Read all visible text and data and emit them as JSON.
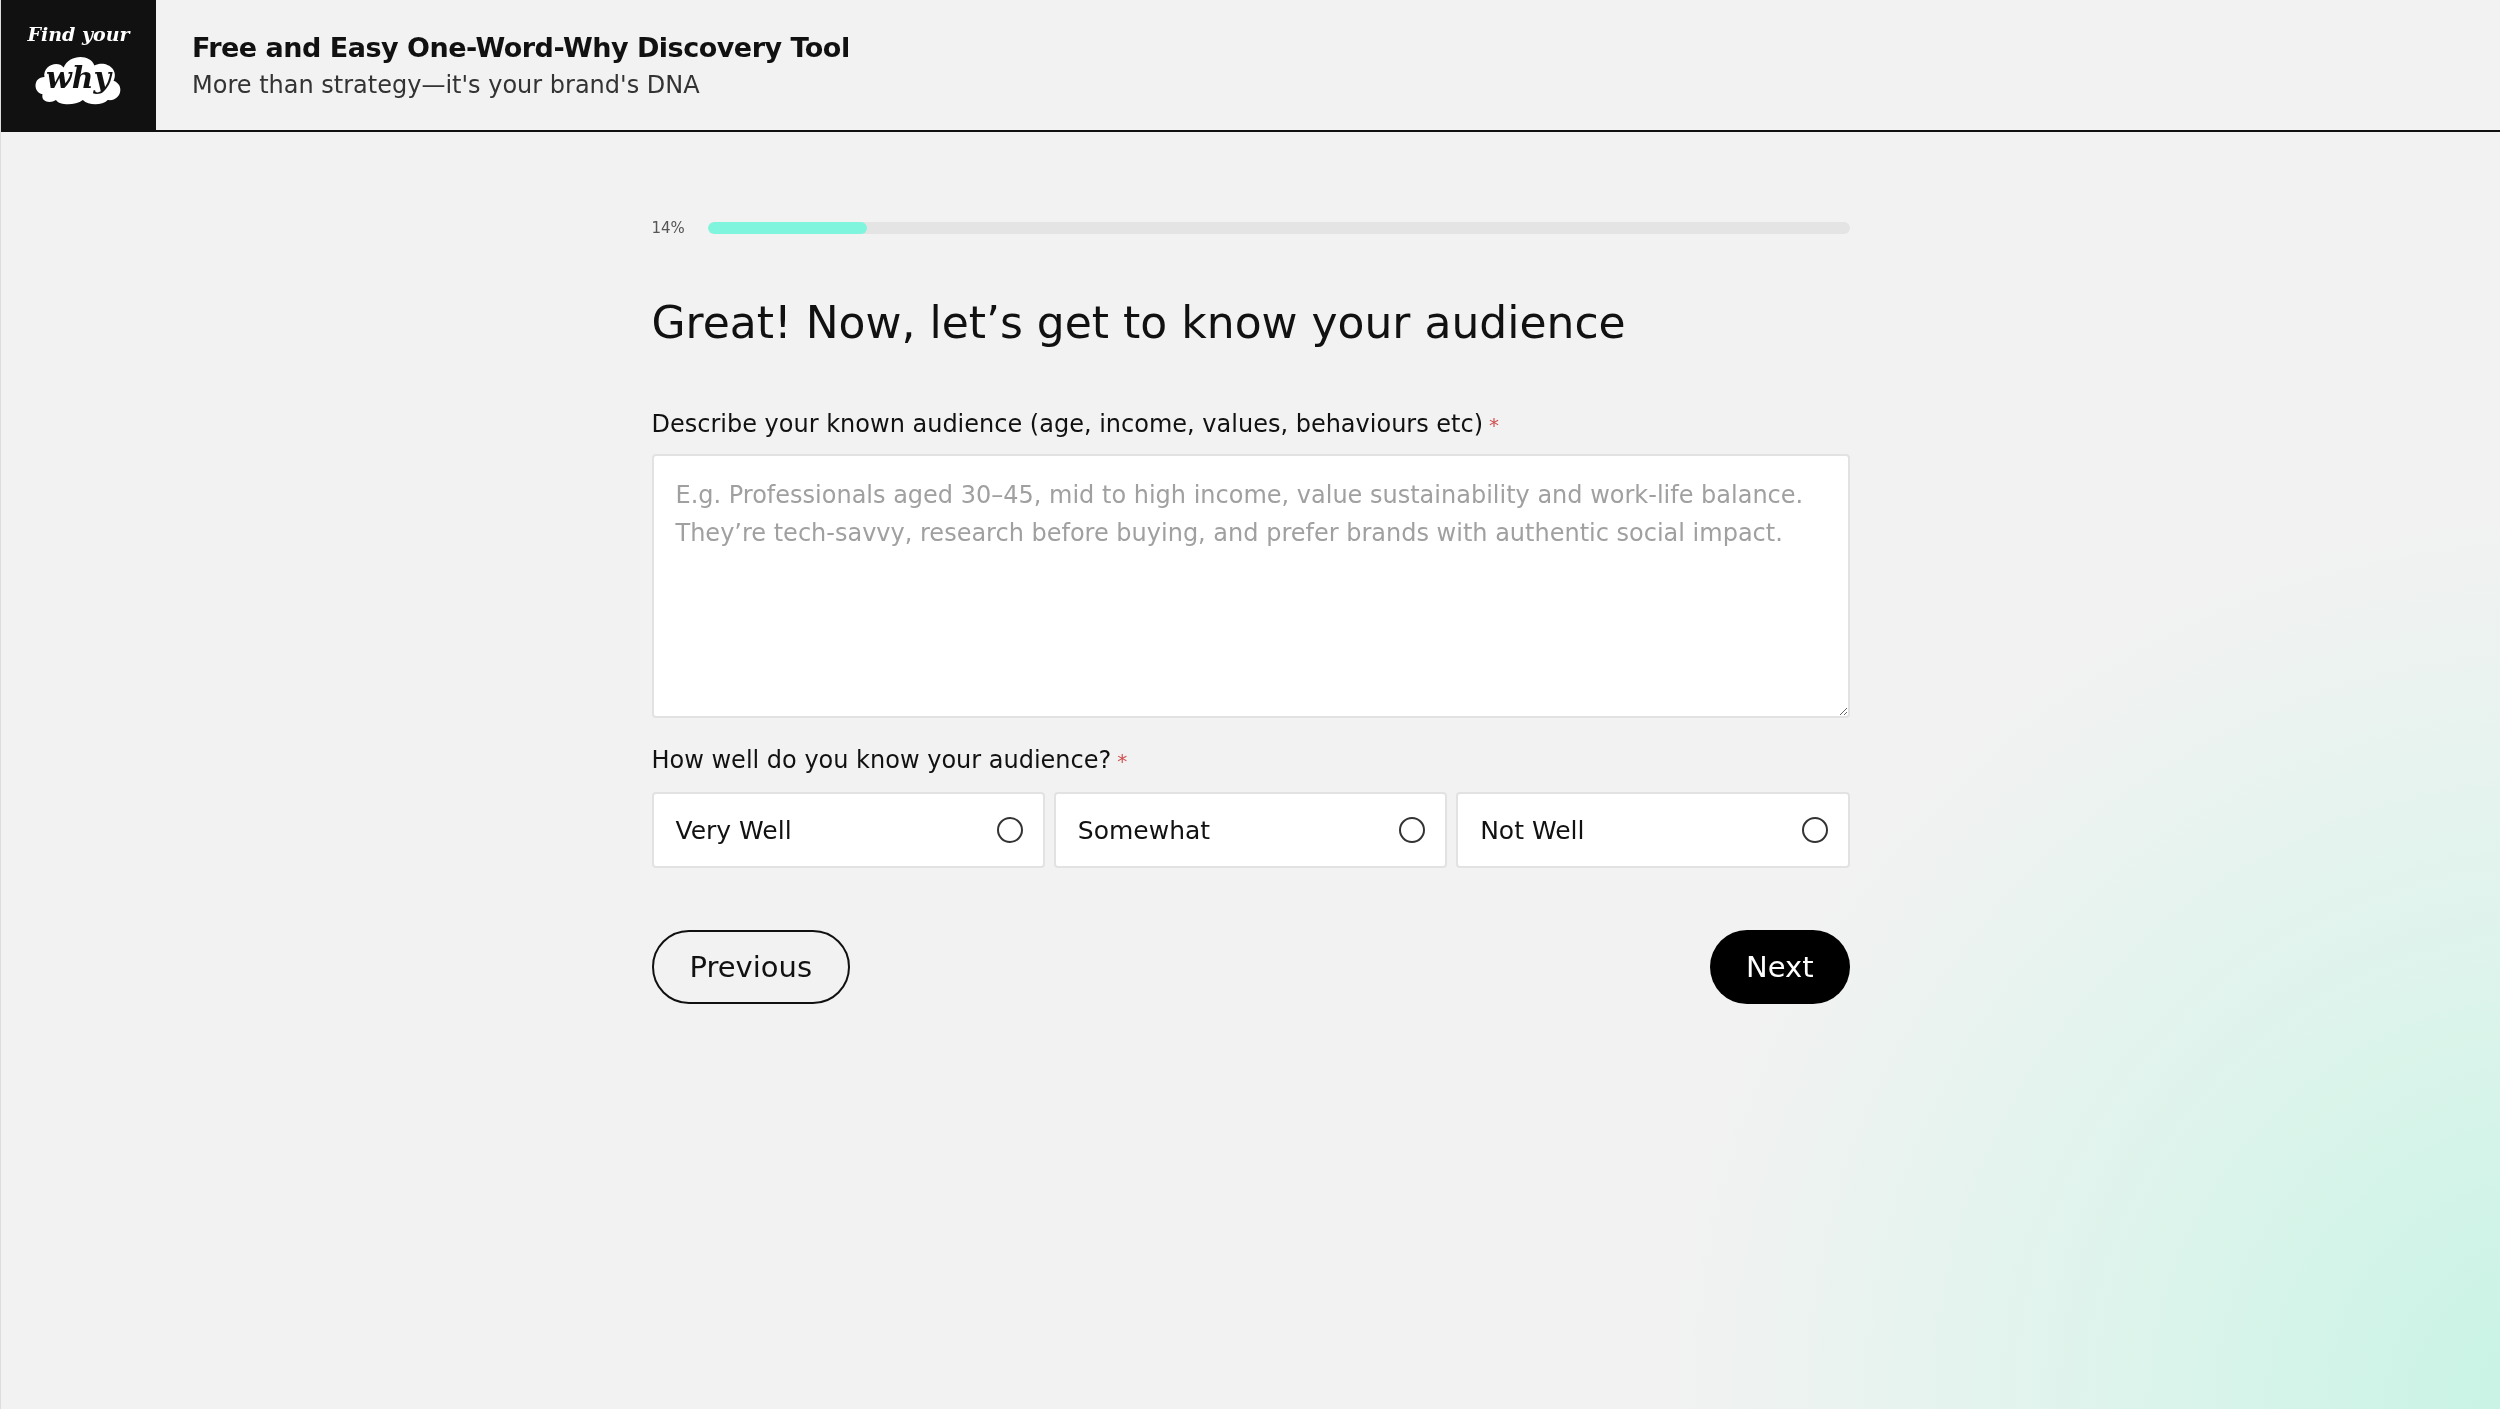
{
  "header": {
    "logo": {
      "top": "Find your",
      "bottom": "why"
    },
    "title": "Free and Easy One-Word-Why Discovery Tool",
    "subtitle": "More than strategy—it's your brand's DNA"
  },
  "progress": {
    "reading": "14%",
    "level": 0.14
  },
  "heading": "Great! Now, let’s get to know your audience",
  "audience_field": {
    "label": "Describe your known audience (age, income, values, behaviours etc)",
    "required_mark": "*",
    "placeholder": "E.g. Professionals aged 30–45, mid to high income, value sustainability and work-life balance.\nThey’re tech-savvy, research before buying, and prefer brands with authentic social impact."
  },
  "familiarity": {
    "label": "How well do you know your audience?",
    "required_mark": "*",
    "options": [
      {
        "label": "Very Well",
        "selected": false
      },
      {
        "label": "Somewhat",
        "selected": false
      },
      {
        "label": "Not Well",
        "selected": false
      }
    ]
  },
  "buttons": {
    "previous": "Previous",
    "next": "Next"
  }
}
